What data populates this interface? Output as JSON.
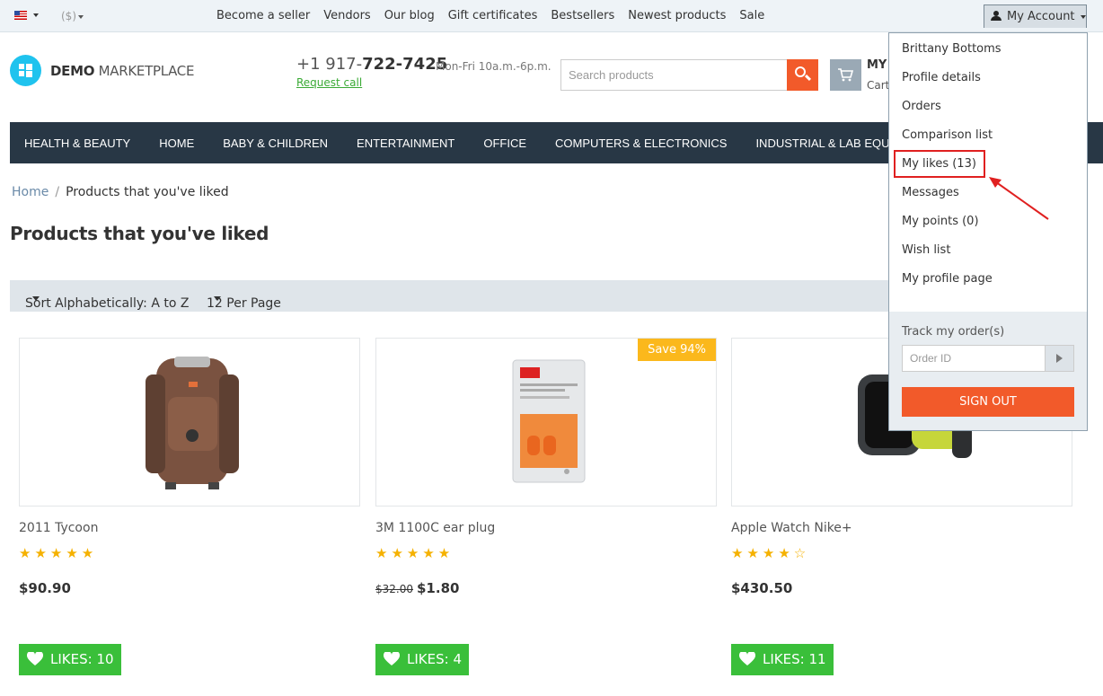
{
  "topbar": {
    "currency": "($)",
    "links": [
      "Become a seller",
      "Vendors",
      "Our blog",
      "Gift certificates",
      "Bestsellers",
      "Newest products",
      "Sale"
    ],
    "account_label": "My Account"
  },
  "header": {
    "logo_bold": "DEMO",
    "logo_rest": " MARKETPLACE",
    "phone_prefix": "+1 917-",
    "phone_main": "722-7425",
    "hours": "Mon-Fri 10a.m.-6p.m.",
    "request_call": "Request call",
    "search_placeholder": "Search products",
    "cart_title": "MY",
    "cart_sub": "Cart"
  },
  "menu": [
    "HEALTH & BEAUTY",
    "HOME",
    "BABY & CHILDREN",
    "ENTERTAINMENT",
    "OFFICE",
    "COMPUTERS & ELECTRONICS",
    "INDUSTRIAL & LAB EQUIPMENT"
  ],
  "breadcrumb": {
    "home": "Home",
    "separator": "/",
    "current": "Products that you've liked"
  },
  "page_title": "Products that you've liked",
  "sorting": {
    "sort_label": "Sort Alphabetically: A to Z",
    "per_page_label": "12 Per Page"
  },
  "products": [
    {
      "name": "2011 Tycoon",
      "rating": 5,
      "stars": "★★★★★",
      "price": "$90.90",
      "old_price": "",
      "likes": "LIKES: 10",
      "badge": ""
    },
    {
      "name": "3M 1100C ear plug",
      "rating": 5,
      "stars": "★★★★★",
      "price": "$1.80",
      "old_price": "$32.00",
      "likes": "LIKES: 4",
      "badge": "Save 94%"
    },
    {
      "name": "Apple Watch Nike+",
      "rating": 4,
      "stars": "★★★★☆",
      "price": "$430.50",
      "old_price": "",
      "likes": "LIKES: 11",
      "badge": ""
    }
  ],
  "account_menu": {
    "items": [
      "Brittany Bottoms",
      "Profile details",
      "Orders",
      "Comparison list",
      "My likes (13)",
      "Messages",
      "My points (0)",
      "Wish list",
      "My profile page"
    ],
    "track_label": "Track my order(s)",
    "order_placeholder": "Order ID",
    "sign_out": "SIGN OUT"
  },
  "colors": {
    "accent_orange": "#f25a2a",
    "like_green": "#3abf3a",
    "nav_dark": "#283745",
    "badge_yellow": "#fbb81c",
    "highlight_red": "#e02020"
  }
}
